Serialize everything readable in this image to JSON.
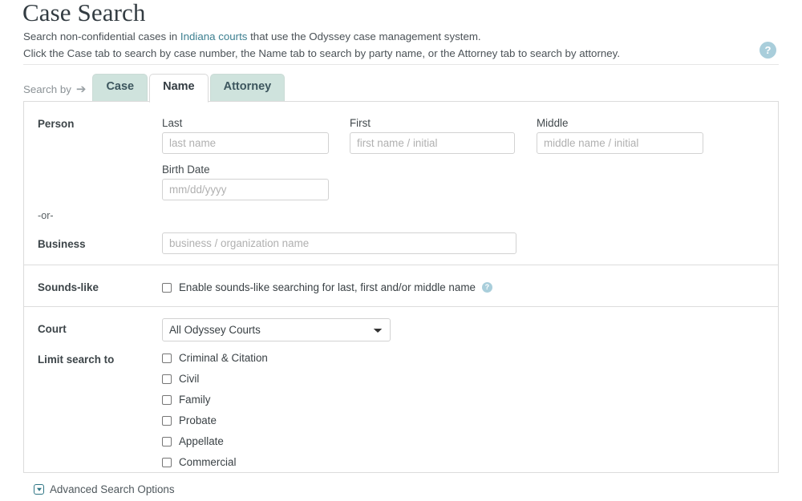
{
  "header": {
    "title": "Case Search",
    "intro_line1_before": "Search non-confidential cases in ",
    "intro_link": "Indiana courts",
    "intro_line1_after": " that use the Odyssey case management system.",
    "intro_line2": "Click the Case tab to search by case number, the Name tab to search by party name, or the Attorney tab to search by attorney.",
    "help_icon": "?"
  },
  "tabs": {
    "search_by_label": "Search by",
    "arrow_icon": "➔",
    "items": [
      {
        "label": "Case",
        "active": false
      },
      {
        "label": "Name",
        "active": true
      },
      {
        "label": "Attorney",
        "active": false
      }
    ]
  },
  "person": {
    "row_label": "Person",
    "last": {
      "label": "Last",
      "placeholder": "last name",
      "value": ""
    },
    "first": {
      "label": "First",
      "placeholder": "first name / initial",
      "value": ""
    },
    "middle": {
      "label": "Middle",
      "placeholder": "middle name / initial",
      "value": ""
    },
    "birth_date": {
      "label": "Birth Date",
      "placeholder": "mm/dd/yyyy",
      "value": ""
    },
    "or_separator": "-or-",
    "business": {
      "label": "Business",
      "placeholder": "business / organization name",
      "value": ""
    }
  },
  "sounds_like": {
    "row_label": "Sounds-like",
    "checkbox_label": "Enable sounds-like searching for last, first and/or middle name",
    "checked": false,
    "help_icon": "?"
  },
  "court": {
    "row_label": "Court",
    "selected": "All Odyssey Courts",
    "options": [
      "All Odyssey Courts"
    ]
  },
  "limit_search": {
    "row_label": "Limit search to",
    "options": [
      {
        "label": "Criminal & Citation",
        "checked": false
      },
      {
        "label": "Civil",
        "checked": false
      },
      {
        "label": "Family",
        "checked": false
      },
      {
        "label": "Probate",
        "checked": false
      },
      {
        "label": "Appellate",
        "checked": false
      },
      {
        "label": "Commercial",
        "checked": false
      }
    ]
  },
  "advanced": {
    "label": "Advanced Search Options",
    "icon": "expand-box-icon"
  },
  "colors": {
    "tab_inactive_bg": "#cfe3dd",
    "link": "#3c7f90",
    "help_circle": "#a9cedb",
    "accent_teal": "#2e7584",
    "panel_border": "#dcdcdc"
  }
}
